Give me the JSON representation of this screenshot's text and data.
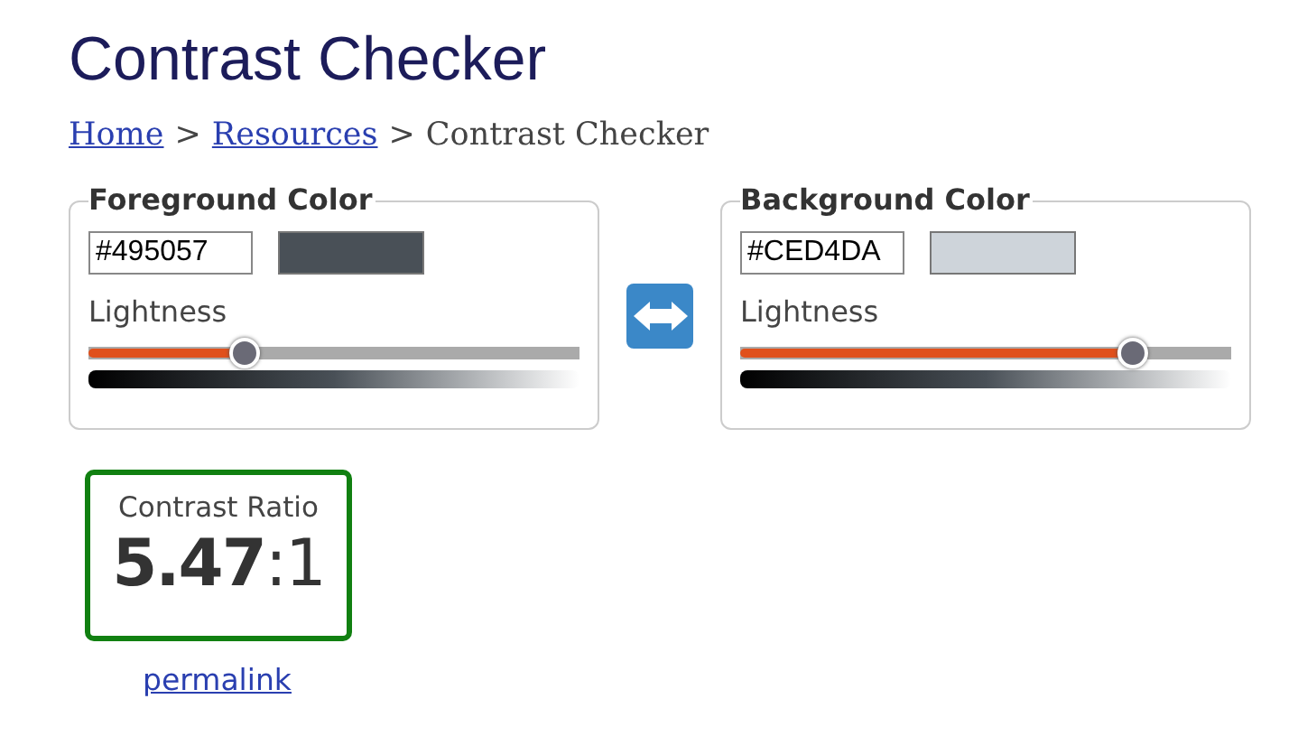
{
  "title": "Contrast Checker",
  "breadcrumb": [
    {
      "label": "Home",
      "kind": "link"
    },
    {
      "label": ">",
      "kind": "separator"
    },
    {
      "label": "Resources",
      "kind": "link"
    },
    {
      "label": ">",
      "kind": "separator"
    },
    {
      "label": "Contrast Checker",
      "kind": "current"
    }
  ],
  "panels": [
    {
      "legend": "Foreground Color",
      "value": "#495057",
      "color": "#495057",
      "slider_label": "Lightness",
      "level": 0.32
    },
    {
      "legend": "Background Color",
      "value": "#CED4DA",
      "color": "#ced4da",
      "slider_label": "Lightness",
      "level": 0.8
    }
  ],
  "result": {
    "label": "Contrast Ratio",
    "ratio": "**5.47**:1",
    "passes": true
  },
  "permalink": "permalink"
}
